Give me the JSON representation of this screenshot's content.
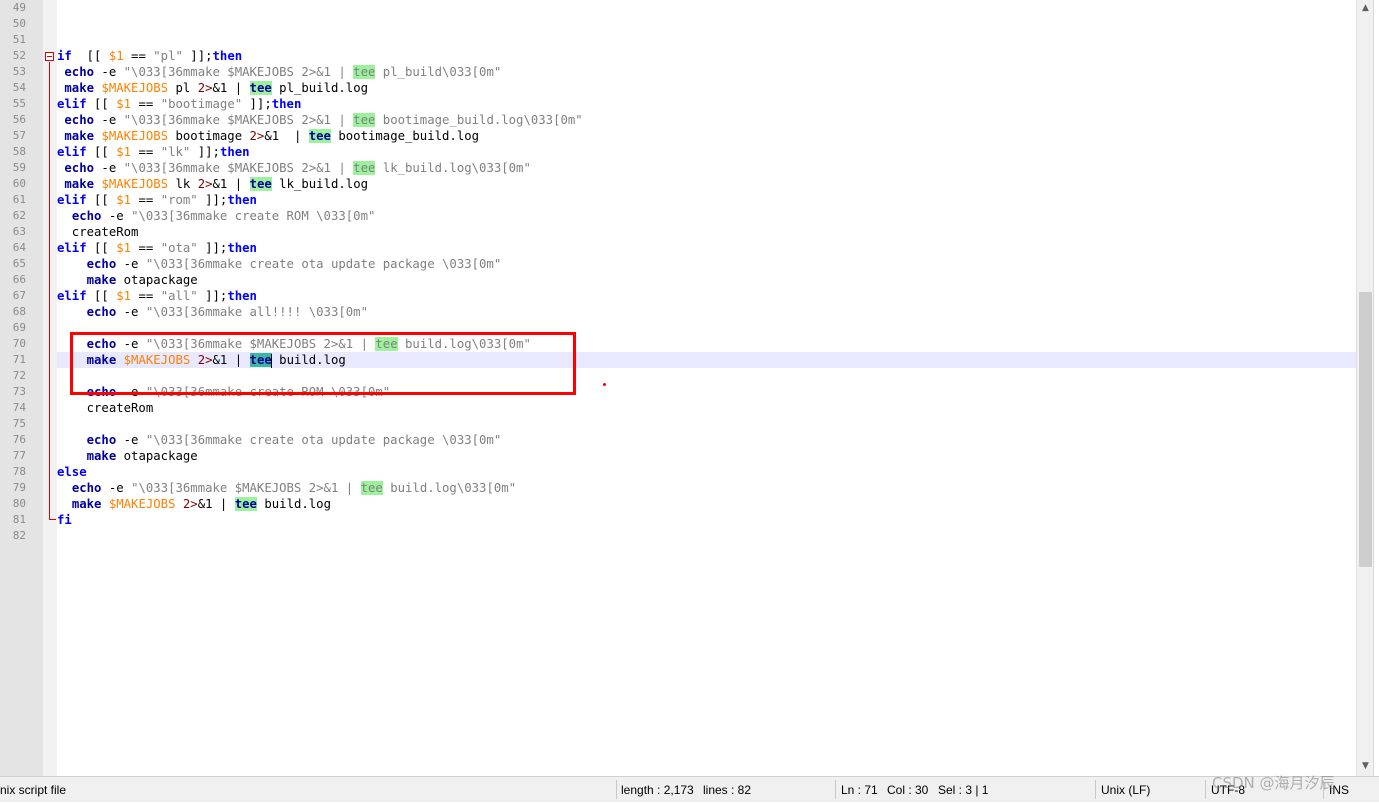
{
  "editor": {
    "lines": [
      {
        "num": "49",
        "parts": []
      },
      {
        "num": "50",
        "parts": []
      },
      {
        "num": "51",
        "parts": []
      },
      {
        "num": "52",
        "parts": [
          [
            "kw",
            "if"
          ],
          [
            "",
            "  [[ "
          ],
          [
            "var",
            "$1"
          ],
          [
            "",
            " == "
          ],
          [
            "str",
            "\"pl\""
          ],
          [
            "",
            " ]];"
          ],
          [
            "kw",
            "then"
          ]
        ]
      },
      {
        "num": "53",
        "parts": [
          [
            "",
            " "
          ],
          [
            "cmd",
            "echo"
          ],
          [
            "",
            " -e "
          ],
          [
            "str",
            "\"\\033[36mmake $MAKEJOBS 2>&1 | "
          ],
          [
            "tee str",
            "tee"
          ],
          [
            "str",
            " pl_build\\033[0m\""
          ]
        ]
      },
      {
        "num": "54",
        "parts": [
          [
            "",
            " "
          ],
          [
            "cmd",
            "make"
          ],
          [
            "",
            " "
          ],
          [
            "var",
            "$MAKEJOBS"
          ],
          [
            "",
            " pl "
          ],
          [
            "op",
            "2>"
          ],
          [
            "",
            "&1 | "
          ],
          [
            "tee cmd",
            "tee"
          ],
          [
            "",
            " pl_build.log"
          ]
        ]
      },
      {
        "num": "55",
        "parts": [
          [
            "kw",
            "elif"
          ],
          [
            "",
            " [[ "
          ],
          [
            "var",
            "$1"
          ],
          [
            "",
            " == "
          ],
          [
            "str",
            "\"bootimage\""
          ],
          [
            "",
            " ]];"
          ],
          [
            "kw",
            "then"
          ]
        ]
      },
      {
        "num": "56",
        "parts": [
          [
            "",
            " "
          ],
          [
            "cmd",
            "echo"
          ],
          [
            "",
            " -e "
          ],
          [
            "str",
            "\"\\033[36mmake $MAKEJOBS 2>&1 | "
          ],
          [
            "tee str",
            "tee"
          ],
          [
            "str",
            " bootimage_build.log\\033[0m\""
          ]
        ]
      },
      {
        "num": "57",
        "parts": [
          [
            "",
            " "
          ],
          [
            "cmd",
            "make"
          ],
          [
            "",
            " "
          ],
          [
            "var",
            "$MAKEJOBS"
          ],
          [
            "",
            " bootimage "
          ],
          [
            "op",
            "2>"
          ],
          [
            "",
            "&1  | "
          ],
          [
            "tee cmd",
            "tee"
          ],
          [
            "",
            " bootimage_build.log"
          ]
        ]
      },
      {
        "num": "58",
        "parts": [
          [
            "kw",
            "elif"
          ],
          [
            "",
            " [[ "
          ],
          [
            "var",
            "$1"
          ],
          [
            "",
            " == "
          ],
          [
            "str",
            "\"lk\""
          ],
          [
            "",
            " ]];"
          ],
          [
            "kw",
            "then"
          ]
        ]
      },
      {
        "num": "59",
        "parts": [
          [
            "",
            " "
          ],
          [
            "cmd",
            "echo"
          ],
          [
            "",
            " -e "
          ],
          [
            "str",
            "\"\\033[36mmake $MAKEJOBS 2>&1 | "
          ],
          [
            "tee str",
            "tee"
          ],
          [
            "str",
            " lk_build.log\\033[0m\""
          ]
        ]
      },
      {
        "num": "60",
        "parts": [
          [
            "",
            " "
          ],
          [
            "cmd",
            "make"
          ],
          [
            "",
            " "
          ],
          [
            "var",
            "$MAKEJOBS"
          ],
          [
            "",
            " lk "
          ],
          [
            "op",
            "2>"
          ],
          [
            "",
            "&1 | "
          ],
          [
            "tee cmd",
            "tee"
          ],
          [
            "",
            " lk_build.log"
          ]
        ]
      },
      {
        "num": "61",
        "parts": [
          [
            "kw",
            "elif"
          ],
          [
            "",
            " [[ "
          ],
          [
            "var",
            "$1"
          ],
          [
            "",
            " == "
          ],
          [
            "str",
            "\"rom\""
          ],
          [
            "",
            " ]];"
          ],
          [
            "kw",
            "then"
          ]
        ]
      },
      {
        "num": "62",
        "parts": [
          [
            "",
            "  "
          ],
          [
            "cmd",
            "echo"
          ],
          [
            "",
            " -e "
          ],
          [
            "str",
            "\"\\033[36mmake create ROM \\033[0m\""
          ]
        ]
      },
      {
        "num": "63",
        "parts": [
          [
            "",
            "  createRom"
          ]
        ]
      },
      {
        "num": "64",
        "parts": [
          [
            "kw",
            "elif"
          ],
          [
            "",
            " [[ "
          ],
          [
            "var",
            "$1"
          ],
          [
            "",
            " == "
          ],
          [
            "str",
            "\"ota\""
          ],
          [
            "",
            " ]];"
          ],
          [
            "kw",
            "then"
          ]
        ]
      },
      {
        "num": "65",
        "parts": [
          [
            "",
            "    "
          ],
          [
            "cmd",
            "echo"
          ],
          [
            "",
            " -e "
          ],
          [
            "str",
            "\"\\033[36mmake create ota update package \\033[0m\""
          ]
        ]
      },
      {
        "num": "66",
        "parts": [
          [
            "",
            "    "
          ],
          [
            "cmd",
            "make"
          ],
          [
            "",
            " otapackage"
          ]
        ]
      },
      {
        "num": "67",
        "parts": [
          [
            "kw",
            "elif"
          ],
          [
            "",
            " [[ "
          ],
          [
            "var",
            "$1"
          ],
          [
            "",
            " == "
          ],
          [
            "str",
            "\"all\""
          ],
          [
            "",
            " ]];"
          ],
          [
            "kw",
            "then"
          ]
        ]
      },
      {
        "num": "68",
        "parts": [
          [
            "",
            "    "
          ],
          [
            "cmd",
            "echo"
          ],
          [
            "",
            " -e "
          ],
          [
            "str",
            "\"\\033[36mmake all!!!! \\033[0m\""
          ]
        ]
      },
      {
        "num": "69",
        "parts": []
      },
      {
        "num": "70",
        "parts": [
          [
            "",
            "    "
          ],
          [
            "cmd",
            "echo"
          ],
          [
            "",
            " -e "
          ],
          [
            "str",
            "\"\\033[36mmake $MAKEJOBS 2>&1 | "
          ],
          [
            "tee str",
            "tee"
          ],
          [
            "str",
            " build.log\\033[0m\""
          ]
        ]
      },
      {
        "num": "71",
        "parts": [
          [
            "",
            "    "
          ],
          [
            "cmd",
            "make"
          ],
          [
            "",
            " "
          ],
          [
            "var",
            "$MAKEJOBS"
          ],
          [
            "",
            " "
          ],
          [
            "op",
            "2>"
          ],
          [
            "",
            "&1 | "
          ],
          [
            "tee-sel cmd",
            "tee"
          ],
          [
            "",
            " build.log"
          ]
        ]
      },
      {
        "num": "72",
        "parts": []
      },
      {
        "num": "73",
        "parts": [
          [
            "",
            "    "
          ],
          [
            "cmd",
            "echo"
          ],
          [
            "",
            " -e "
          ],
          [
            "str",
            "\"\\033[36mmake create ROM \\033[0m\""
          ]
        ]
      },
      {
        "num": "74",
        "parts": [
          [
            "",
            "    createRom"
          ]
        ]
      },
      {
        "num": "75",
        "parts": []
      },
      {
        "num": "76",
        "parts": [
          [
            "",
            "    "
          ],
          [
            "cmd",
            "echo"
          ],
          [
            "",
            " -e "
          ],
          [
            "str",
            "\"\\033[36mmake create ota update package \\033[0m\""
          ]
        ]
      },
      {
        "num": "77",
        "parts": [
          [
            "",
            "    "
          ],
          [
            "cmd",
            "make"
          ],
          [
            "",
            " otapackage"
          ]
        ]
      },
      {
        "num": "78",
        "parts": [
          [
            "kw",
            "else"
          ]
        ]
      },
      {
        "num": "79",
        "parts": [
          [
            "",
            "  "
          ],
          [
            "cmd",
            "echo"
          ],
          [
            "",
            " -e "
          ],
          [
            "str",
            "\"\\033[36mmake $MAKEJOBS 2>&1 | "
          ],
          [
            "tee str",
            "tee"
          ],
          [
            "str",
            " build.log\\033[0m\""
          ]
        ]
      },
      {
        "num": "80",
        "parts": [
          [
            "",
            "  "
          ],
          [
            "cmd",
            "make"
          ],
          [
            "",
            " "
          ],
          [
            "var",
            "$MAKEJOBS"
          ],
          [
            "",
            " "
          ],
          [
            "op",
            "2>"
          ],
          [
            "",
            "&1 | "
          ],
          [
            "tee cmd",
            "tee"
          ],
          [
            "",
            " build.log"
          ]
        ]
      },
      {
        "num": "81",
        "parts": [
          [
            "kw",
            "fi"
          ]
        ]
      },
      {
        "num": "82",
        "parts": []
      }
    ],
    "current_line": "71"
  },
  "scrollbar": {
    "up_arrow": "▲",
    "down_arrow": "▼"
  },
  "statusbar": {
    "file_type": "nix script file",
    "length": "length : 2,173",
    "lines": "lines : 82",
    "ln": "Ln : 71",
    "col": "Col : 30",
    "sel": "Sel : 3 | 1",
    "eol": "Unix (LF)",
    "encoding": "UTF-8",
    "mode": "INS"
  },
  "watermark": "CSDN @海月汐辰",
  "colors": {
    "keyword": "#0000ff",
    "command": "#0000a0",
    "variable": "#ff8000",
    "string": "#808080",
    "tee_highlight": "#9bf29b",
    "annotation_box": "#ff0000"
  }
}
